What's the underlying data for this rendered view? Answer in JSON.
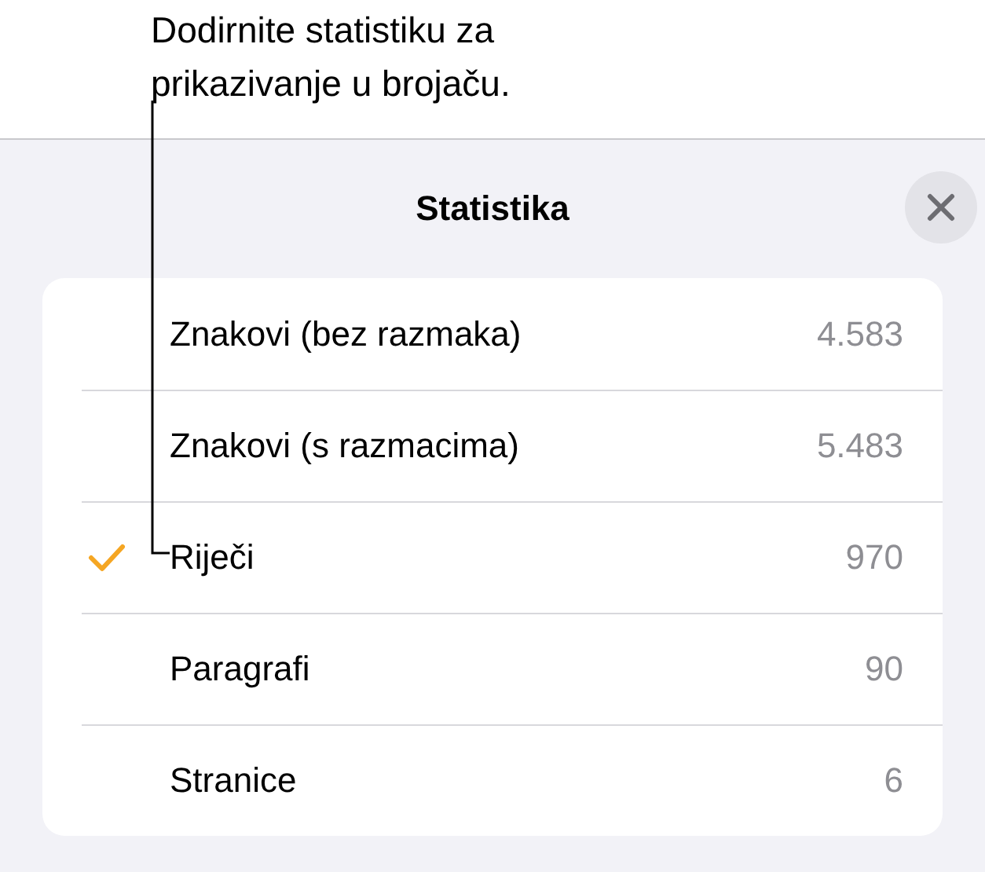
{
  "callout": "Dodirnite statistiku za prikazivanje u brojaču.",
  "panel": {
    "title": "Statistika"
  },
  "rows": [
    {
      "label": "Znakovi (bez razmaka)",
      "value": "4.583",
      "selected": false
    },
    {
      "label": "Znakovi (s razmacima)",
      "value": "5.483",
      "selected": false
    },
    {
      "label": "Riječi",
      "value": "970",
      "selected": true
    },
    {
      "label": "Paragrafi",
      "value": "90",
      "selected": false
    },
    {
      "label": "Stranice",
      "value": "6",
      "selected": false
    }
  ]
}
